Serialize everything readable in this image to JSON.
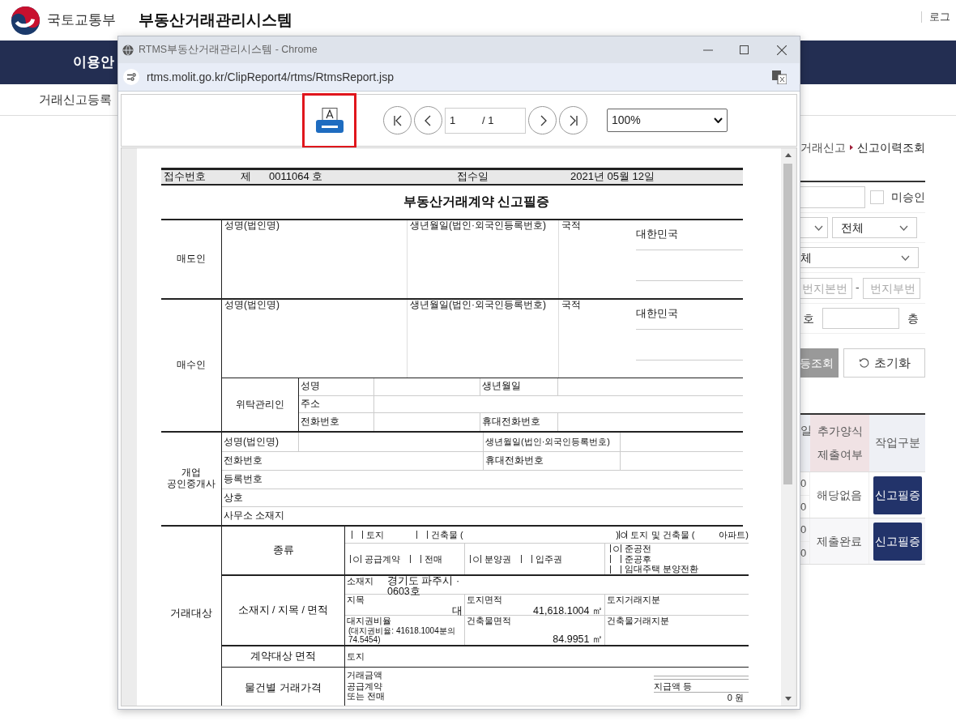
{
  "site": {
    "ministry": "국토교통부",
    "system": "부동산거래관리시스템",
    "login": "로그"
  },
  "nav": {
    "menu": "이용안"
  },
  "subnav": {
    "item": "거래신고등록"
  },
  "breadcrumb": [
    {
      "label": "거래신고"
    },
    {
      "label": "신고이력조회"
    }
  ],
  "filters": {
    "unapproved": {
      "label": "미승인",
      "checked": false
    },
    "select_2": "전체",
    "select_3": "체",
    "lot_main_placeholder": "번지본번",
    "dash": "-",
    "lot_sub_placeholder": "번지부번",
    "ho_label": "호",
    "floor_label": "층",
    "search_button": "등조회",
    "reset_button": "초기화"
  },
  "results": {
    "columns": [
      {
        "label": "일",
        "color": "#eef0f5"
      },
      {
        "label": "추가양식 제출여부",
        "color": "#f0e2e4"
      },
      {
        "label": "작업구분",
        "color": "#eef0f5"
      }
    ],
    "rows": [
      {
        "column_1": [
          "0",
          "0"
        ],
        "status": "해당없음",
        "action": "신고필증"
      },
      {
        "column_1": [
          "0",
          "0"
        ],
        "status": "제출완료",
        "action": "신고필증"
      }
    ]
  },
  "popup": {
    "title": "RTMS부동산거래관리시스템 - Chrome",
    "url": "rtms.molit.go.kr/ClipReport4/rtms/RtmsReport.jsp",
    "toolbar": {
      "print_highlighted": true,
      "page": "1",
      "page_total": "/ 1",
      "zoom": "100%"
    },
    "report": {
      "header": {
        "number_label": "접수번호",
        "number_prefix": "제",
        "number": "0011064 호",
        "date_label": "접수일",
        "date": "2021년 05월 12일"
      },
      "title": "부동산거래계약 신고필증",
      "seller": {
        "role": "매도인",
        "name_label": "성명(법인명)",
        "birth_label": "생년월일(법인·외국인등록번호)",
        "nationality_label": "국적",
        "nationality": "대한민국"
      },
      "buyer": {
        "role": "매수인",
        "name_label": "성명(법인명)",
        "birth_label": "생년월일(법인·외국인등록번호)",
        "nationality_label": "국적",
        "nationality": "대한민국",
        "trustee": {
          "role": "위탁관리인",
          "name_label": "성명",
          "birth_label": "생년월일",
          "address_label": "주소",
          "phone_label": "전화번호",
          "mobile_label": "휴대전화번호"
        }
      },
      "broker": {
        "role": "개업 공인중개사",
        "name_label": "성명(법인명)",
        "birth_label": "생년월일(법인·외국인등록번호)",
        "phone_label": "전화번호",
        "mobile_label": "휴대전화번호",
        "registration_label": "등록번호",
        "business_label": "상호",
        "office_label": "사무소 소재지"
      },
      "property": {
        "role": "거래대상",
        "type_label": "종류",
        "type_options": [
          {
            "label": "토지",
            "checked": false
          },
          {
            "label": "건축물 (",
            "checked": false,
            "suffix": ")"
          },
          {
            "label": "토지 및 건축물 (",
            "checked": true,
            "value": "아파트",
            "suffix": ")"
          }
        ],
        "sale_groups": [
          [
            {
              "label": "공급계약",
              "checked": true
            },
            {
              "label": "전매",
              "checked": false
            }
          ],
          [
            {
              "label": "분양권",
              "checked": true
            },
            {
              "label": "입주권",
              "checked": false
            }
          ],
          [
            {
              "label": "준공전",
              "checked": true
            },
            {
              "label": "준공후",
              "checked": false
            },
            {
              "label": "임대주택 분양전환",
              "checked": false
            }
          ]
        ],
        "location_section_label": "소재지 / 지목 / 면적",
        "location_label": "소재지",
        "location": "경기도 파주시 ·",
        "unit": "0603호",
        "land_category_label": "지목",
        "land_category": "대",
        "land_area_label": "토지면적",
        "land_area": "41,618.1004 ㎡",
        "land_share_label": "토지거래지분",
        "site_ratio_label": "대지권비율",
        "site_ratio": "(대지권비율: 41618.1004분의 74.5454)",
        "building_area_label": "건축물면적",
        "building_area": "84.9951 ㎡",
        "building_share_label": "건축물거래지분",
        "contract_area_label": "계약대상 면적",
        "contract_land_label": "토지",
        "price_label": "물건별 거래가격",
        "amount_label": "거래금액",
        "supply_label": "공급계약 또는 전매",
        "payment_label": "지급액 등",
        "payment": "0 원"
      }
    }
  }
}
